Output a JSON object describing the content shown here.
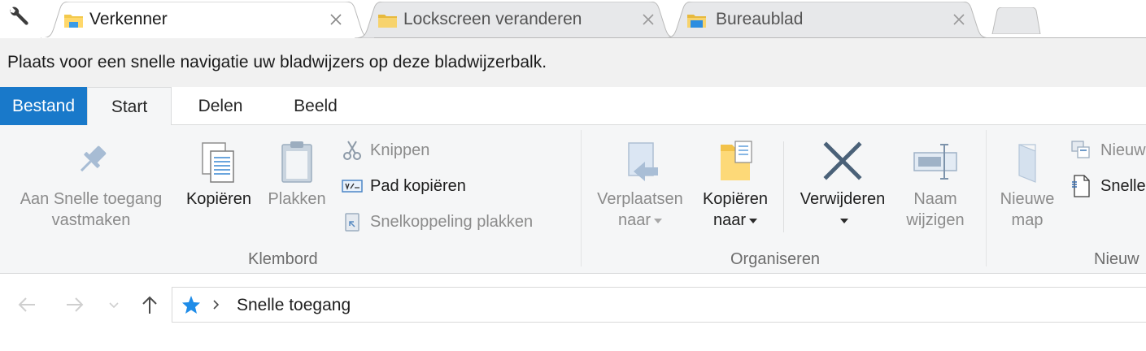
{
  "browser": {
    "tabs": [
      {
        "title": "Verkenner",
        "icon": "explorer-folder-icon",
        "active": true
      },
      {
        "title": "Lockscreen veranderen",
        "icon": "folder-icon",
        "active": false
      },
      {
        "title": "Bureaublad",
        "icon": "desktop-folder-icon",
        "active": false
      }
    ],
    "bookmarks_bar_text": "Plaats voor een snelle navigatie uw bladwijzers op deze bladwijzerbalk."
  },
  "ribbon_tabs": {
    "file": "Bestand",
    "start": "Start",
    "share": "Delen",
    "view": "Beeld"
  },
  "ribbon": {
    "clipboard": {
      "label": "Klembord",
      "pin_line1": "Aan Snelle toegang",
      "pin_line2": "vastmaken",
      "copy": "Kopiëren",
      "paste": "Plakken",
      "cut": "Knippen",
      "copy_path": "Pad kopiëren",
      "paste_shortcut": "Snelkoppeling plakken"
    },
    "organize": {
      "label": "Organiseren",
      "move_line1": "Verplaatsen",
      "move_line2": "naar",
      "copyto_line1": "Kopiëren",
      "copyto_line2": "naar",
      "delete": "Verwijderen",
      "rename_line1": "Naam",
      "rename_line2": "wijzigen"
    },
    "new": {
      "label": "Nieuw",
      "folder_line1": "Nieuwe",
      "folder_line2": "map",
      "new_item": "Nieuw",
      "easy_access": "Snelle"
    }
  },
  "address": {
    "location": "Snelle toegang"
  },
  "colors": {
    "file_tab": "#1979ca",
    "ribbon_bg": "#f5f6f7",
    "delete_icon": "#4a6178",
    "quick_access_star": "#1f8ce8"
  }
}
